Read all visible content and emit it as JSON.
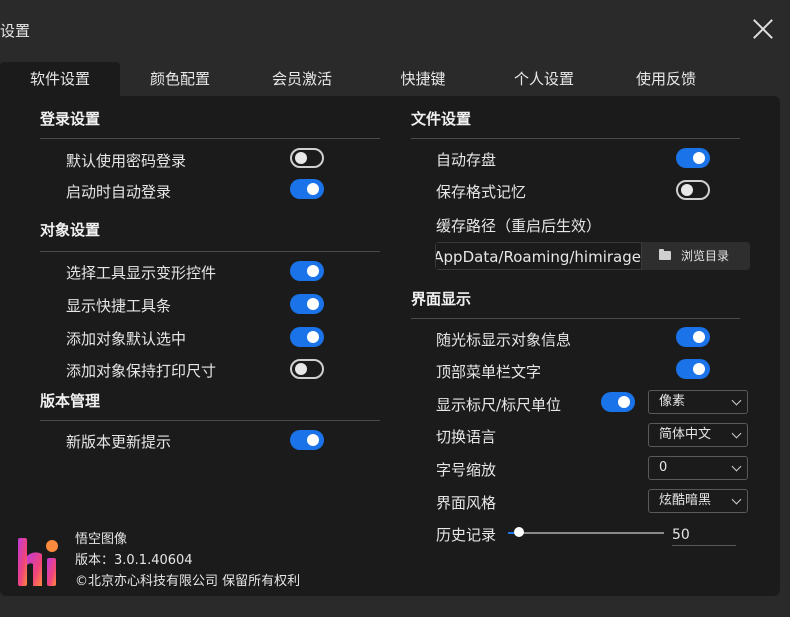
{
  "window": {
    "title": "设置"
  },
  "tabs": [
    "软件设置",
    "颜色配置",
    "会员激活",
    "快捷键",
    "个人设置",
    "使用反馈"
  ],
  "login": {
    "title": "登录设置",
    "items": [
      {
        "label": "默认使用密码登录",
        "on": false
      },
      {
        "label": "启动时自动登录",
        "on": true
      }
    ]
  },
  "object": {
    "title": "对象设置",
    "items": [
      {
        "label": "选择工具显示变形控件",
        "on": true
      },
      {
        "label": "显示快捷工具条",
        "on": true
      },
      {
        "label": "添加对象默认选中",
        "on": true
      },
      {
        "label": "添加对象保持打印尺寸",
        "on": false
      }
    ]
  },
  "version_mgmt": {
    "title": "版本管理",
    "items": [
      {
        "label": "新版本更新提示",
        "on": true
      }
    ]
  },
  "file": {
    "title": "文件设置",
    "items": [
      {
        "label": "自动存盘",
        "on": true
      },
      {
        "label": "保存格式记忆",
        "on": false
      }
    ],
    "cache_label": "缓存路径（重启后生效）",
    "cache_path": "a/AppData/Roaming/himirage",
    "browse_label": "浏览目录"
  },
  "display": {
    "title": "界面显示",
    "toggles": [
      {
        "label": "随光标显示对象信息",
        "on": true
      },
      {
        "label": "顶部菜单栏文字",
        "on": true
      }
    ],
    "ruler": {
      "label": "显示标尺/标尺单位",
      "on": true,
      "unit": "像素"
    },
    "language": {
      "label": "切换语言",
      "value": "简体中文"
    },
    "font_scale": {
      "label": "字号缩放",
      "value": "0"
    },
    "theme": {
      "label": "界面风格",
      "value": "炫酷暗黑"
    },
    "history": {
      "label": "历史记录",
      "value": "50",
      "level": 0.04
    }
  },
  "about": {
    "app_name": "悟空图像",
    "version": "版本：3.0.1.40604",
    "copyright": "©北京亦心科技有限公司 保留所有权利"
  },
  "colors": {
    "accent": "#1a73e8",
    "panel": "#1b1b1b",
    "frame": "#2a2a2a"
  }
}
